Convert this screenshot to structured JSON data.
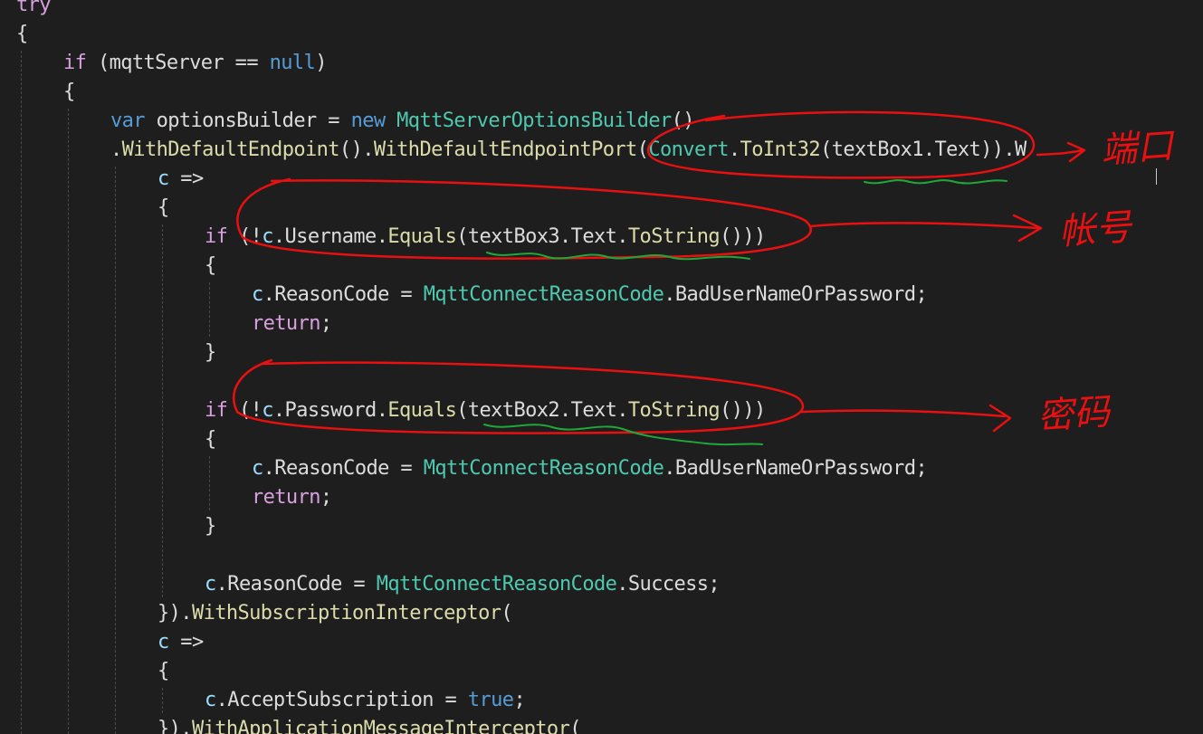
{
  "editor": {
    "lines": [
      {
        "indent": 0,
        "tokens": [
          {
            "t": "try",
            "c": "ctl"
          }
        ]
      },
      {
        "indent": 0,
        "tokens": [
          {
            "t": "{",
            "c": "id"
          }
        ]
      },
      {
        "indent": 1,
        "tokens": [
          {
            "t": "if",
            "c": "ctl"
          },
          {
            "t": " (mqttServer == ",
            "c": "id"
          },
          {
            "t": "null",
            "c": "kw"
          },
          {
            "t": ")",
            "c": "id"
          }
        ]
      },
      {
        "indent": 1,
        "tokens": [
          {
            "t": "{",
            "c": "id"
          }
        ]
      },
      {
        "indent": 2,
        "tokens": [
          {
            "t": "var",
            "c": "kw"
          },
          {
            "t": " optionsBuilder = ",
            "c": "id"
          },
          {
            "t": "new",
            "c": "kw"
          },
          {
            "t": " ",
            "c": "id"
          },
          {
            "t": "MqttServerOptionsBuilder",
            "c": "typ"
          },
          {
            "t": "()",
            "c": "id"
          }
        ]
      },
      {
        "indent": 2,
        "tokens": [
          {
            "t": ".",
            "c": "id"
          },
          {
            "t": "WithDefaultEndpoint",
            "c": "mth"
          },
          {
            "t": "().",
            "c": "id"
          },
          {
            "t": "WithDefaultEndpointPort",
            "c": "mth"
          },
          {
            "t": "(",
            "c": "id"
          },
          {
            "t": "Convert",
            "c": "typ"
          },
          {
            "t": ".",
            "c": "id"
          },
          {
            "t": "ToInt32",
            "c": "mth"
          },
          {
            "t": "(textBox1.Text)).W",
            "c": "id"
          }
        ]
      },
      {
        "indent": 3,
        "tokens": [
          {
            "t": "c",
            "c": "var"
          },
          {
            "t": " =>",
            "c": "id"
          }
        ]
      },
      {
        "indent": 3,
        "tokens": [
          {
            "t": "{",
            "c": "id"
          }
        ]
      },
      {
        "indent": 4,
        "tokens": [
          {
            "t": "if",
            "c": "ctl"
          },
          {
            "t": " (!",
            "c": "id"
          },
          {
            "t": "c",
            "c": "var"
          },
          {
            "t": ".Username.",
            "c": "id"
          },
          {
            "t": "Equals",
            "c": "mth"
          },
          {
            "t": "(textBox3.Text.",
            "c": "id"
          },
          {
            "t": "ToString",
            "c": "mth"
          },
          {
            "t": "()))",
            "c": "id"
          }
        ]
      },
      {
        "indent": 4,
        "tokens": [
          {
            "t": "{",
            "c": "id"
          }
        ]
      },
      {
        "indent": 5,
        "tokens": [
          {
            "t": "c",
            "c": "var"
          },
          {
            "t": ".ReasonCode = ",
            "c": "id"
          },
          {
            "t": "MqttConnectReasonCode",
            "c": "typ"
          },
          {
            "t": ".BadUserNameOrPassword;",
            "c": "id"
          }
        ]
      },
      {
        "indent": 5,
        "tokens": [
          {
            "t": "return",
            "c": "ctl"
          },
          {
            "t": ";",
            "c": "id"
          }
        ]
      },
      {
        "indent": 4,
        "tokens": [
          {
            "t": "}",
            "c": "id"
          }
        ]
      },
      {
        "indent": 0,
        "tokens": []
      },
      {
        "indent": 4,
        "tokens": [
          {
            "t": "if",
            "c": "ctl"
          },
          {
            "t": " (!",
            "c": "id"
          },
          {
            "t": "c",
            "c": "var"
          },
          {
            "t": ".Password.",
            "c": "id"
          },
          {
            "t": "Equals",
            "c": "mth"
          },
          {
            "t": "(textBox2.Text.",
            "c": "id"
          },
          {
            "t": "ToString",
            "c": "mth"
          },
          {
            "t": "()))",
            "c": "id"
          }
        ]
      },
      {
        "indent": 4,
        "tokens": [
          {
            "t": "{",
            "c": "id"
          }
        ]
      },
      {
        "indent": 5,
        "tokens": [
          {
            "t": "c",
            "c": "var"
          },
          {
            "t": ".ReasonCode = ",
            "c": "id"
          },
          {
            "t": "MqttConnectReasonCode",
            "c": "typ"
          },
          {
            "t": ".BadUserNameOrPassword;",
            "c": "id"
          }
        ]
      },
      {
        "indent": 5,
        "tokens": [
          {
            "t": "return",
            "c": "ctl"
          },
          {
            "t": ";",
            "c": "id"
          }
        ]
      },
      {
        "indent": 4,
        "tokens": [
          {
            "t": "}",
            "c": "id"
          }
        ]
      },
      {
        "indent": 0,
        "tokens": []
      },
      {
        "indent": 4,
        "tokens": [
          {
            "t": "c",
            "c": "var"
          },
          {
            "t": ".ReasonCode = ",
            "c": "id"
          },
          {
            "t": "MqttConnectReasonCode",
            "c": "typ"
          },
          {
            "t": ".Success;",
            "c": "id"
          }
        ]
      },
      {
        "indent": 3,
        "tokens": [
          {
            "t": "}).",
            "c": "id"
          },
          {
            "t": "WithSubscriptionInterceptor",
            "c": "mth"
          },
          {
            "t": "(",
            "c": "id"
          }
        ]
      },
      {
        "indent": 3,
        "tokens": [
          {
            "t": "c",
            "c": "var"
          },
          {
            "t": " =>",
            "c": "id"
          }
        ]
      },
      {
        "indent": 3,
        "tokens": [
          {
            "t": "{",
            "c": "id"
          }
        ]
      },
      {
        "indent": 4,
        "tokens": [
          {
            "t": "c",
            "c": "var"
          },
          {
            "t": ".AcceptSubscription = ",
            "c": "id"
          },
          {
            "t": "true",
            "c": "kw"
          },
          {
            "t": ";",
            "c": "id"
          }
        ]
      },
      {
        "indent": 3,
        "tokens": [
          {
            "t": "}).",
            "c": "id"
          },
          {
            "t": "WithApplicationMessageInterceptor",
            "c": "mth"
          },
          {
            "t": "(",
            "c": "id"
          }
        ]
      }
    ]
  },
  "annotations": {
    "port_note": "端口",
    "account_note": "帐号",
    "password_note": "密码",
    "ink_color": "#e81010",
    "underline_color": "#1fa83a"
  },
  "theme": {
    "background": "#1e1e1e",
    "keyword": "#569cd6",
    "control": "#d8a0df",
    "type": "#4ec9b0",
    "method": "#dcdcaa",
    "variable": "#9cdcfe",
    "text": "#dcdcdc"
  }
}
